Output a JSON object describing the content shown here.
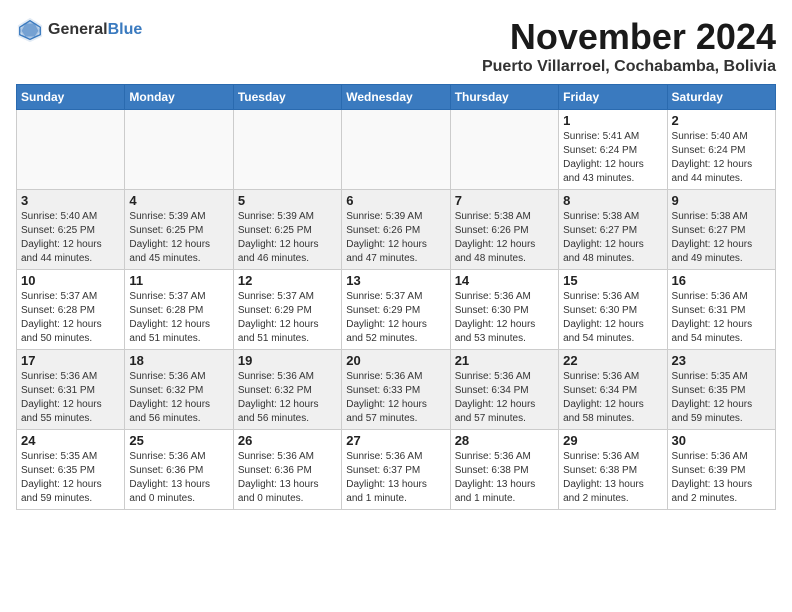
{
  "logo": {
    "line1": "General",
    "line2": "Blue"
  },
  "title": "November 2024",
  "subtitle": "Puerto Villarroel, Cochabamba, Bolivia",
  "days_of_week": [
    "Sunday",
    "Monday",
    "Tuesday",
    "Wednesday",
    "Thursday",
    "Friday",
    "Saturday"
  ],
  "weeks": [
    [
      {
        "num": "",
        "detail": "",
        "empty": true
      },
      {
        "num": "",
        "detail": "",
        "empty": true
      },
      {
        "num": "",
        "detail": "",
        "empty": true
      },
      {
        "num": "",
        "detail": "",
        "empty": true
      },
      {
        "num": "",
        "detail": "",
        "empty": true
      },
      {
        "num": "1",
        "detail": "Sunrise: 5:41 AM\nSunset: 6:24 PM\nDaylight: 12 hours\nand 43 minutes.",
        "empty": false
      },
      {
        "num": "2",
        "detail": "Sunrise: 5:40 AM\nSunset: 6:24 PM\nDaylight: 12 hours\nand 44 minutes.",
        "empty": false
      }
    ],
    [
      {
        "num": "3",
        "detail": "Sunrise: 5:40 AM\nSunset: 6:25 PM\nDaylight: 12 hours\nand 44 minutes.",
        "empty": false
      },
      {
        "num": "4",
        "detail": "Sunrise: 5:39 AM\nSunset: 6:25 PM\nDaylight: 12 hours\nand 45 minutes.",
        "empty": false
      },
      {
        "num": "5",
        "detail": "Sunrise: 5:39 AM\nSunset: 6:25 PM\nDaylight: 12 hours\nand 46 minutes.",
        "empty": false
      },
      {
        "num": "6",
        "detail": "Sunrise: 5:39 AM\nSunset: 6:26 PM\nDaylight: 12 hours\nand 47 minutes.",
        "empty": false
      },
      {
        "num": "7",
        "detail": "Sunrise: 5:38 AM\nSunset: 6:26 PM\nDaylight: 12 hours\nand 48 minutes.",
        "empty": false
      },
      {
        "num": "8",
        "detail": "Sunrise: 5:38 AM\nSunset: 6:27 PM\nDaylight: 12 hours\nand 48 minutes.",
        "empty": false
      },
      {
        "num": "9",
        "detail": "Sunrise: 5:38 AM\nSunset: 6:27 PM\nDaylight: 12 hours\nand 49 minutes.",
        "empty": false
      }
    ],
    [
      {
        "num": "10",
        "detail": "Sunrise: 5:37 AM\nSunset: 6:28 PM\nDaylight: 12 hours\nand 50 minutes.",
        "empty": false
      },
      {
        "num": "11",
        "detail": "Sunrise: 5:37 AM\nSunset: 6:28 PM\nDaylight: 12 hours\nand 51 minutes.",
        "empty": false
      },
      {
        "num": "12",
        "detail": "Sunrise: 5:37 AM\nSunset: 6:29 PM\nDaylight: 12 hours\nand 51 minutes.",
        "empty": false
      },
      {
        "num": "13",
        "detail": "Sunrise: 5:37 AM\nSunset: 6:29 PM\nDaylight: 12 hours\nand 52 minutes.",
        "empty": false
      },
      {
        "num": "14",
        "detail": "Sunrise: 5:36 AM\nSunset: 6:30 PM\nDaylight: 12 hours\nand 53 minutes.",
        "empty": false
      },
      {
        "num": "15",
        "detail": "Sunrise: 5:36 AM\nSunset: 6:30 PM\nDaylight: 12 hours\nand 54 minutes.",
        "empty": false
      },
      {
        "num": "16",
        "detail": "Sunrise: 5:36 AM\nSunset: 6:31 PM\nDaylight: 12 hours\nand 54 minutes.",
        "empty": false
      }
    ],
    [
      {
        "num": "17",
        "detail": "Sunrise: 5:36 AM\nSunset: 6:31 PM\nDaylight: 12 hours\nand 55 minutes.",
        "empty": false
      },
      {
        "num": "18",
        "detail": "Sunrise: 5:36 AM\nSunset: 6:32 PM\nDaylight: 12 hours\nand 56 minutes.",
        "empty": false
      },
      {
        "num": "19",
        "detail": "Sunrise: 5:36 AM\nSunset: 6:32 PM\nDaylight: 12 hours\nand 56 minutes.",
        "empty": false
      },
      {
        "num": "20",
        "detail": "Sunrise: 5:36 AM\nSunset: 6:33 PM\nDaylight: 12 hours\nand 57 minutes.",
        "empty": false
      },
      {
        "num": "21",
        "detail": "Sunrise: 5:36 AM\nSunset: 6:34 PM\nDaylight: 12 hours\nand 57 minutes.",
        "empty": false
      },
      {
        "num": "22",
        "detail": "Sunrise: 5:36 AM\nSunset: 6:34 PM\nDaylight: 12 hours\nand 58 minutes.",
        "empty": false
      },
      {
        "num": "23",
        "detail": "Sunrise: 5:35 AM\nSunset: 6:35 PM\nDaylight: 12 hours\nand 59 minutes.",
        "empty": false
      }
    ],
    [
      {
        "num": "24",
        "detail": "Sunrise: 5:35 AM\nSunset: 6:35 PM\nDaylight: 12 hours\nand 59 minutes.",
        "empty": false
      },
      {
        "num": "25",
        "detail": "Sunrise: 5:36 AM\nSunset: 6:36 PM\nDaylight: 13 hours\nand 0 minutes.",
        "empty": false
      },
      {
        "num": "26",
        "detail": "Sunrise: 5:36 AM\nSunset: 6:36 PM\nDaylight: 13 hours\nand 0 minutes.",
        "empty": false
      },
      {
        "num": "27",
        "detail": "Sunrise: 5:36 AM\nSunset: 6:37 PM\nDaylight: 13 hours\nand 1 minute.",
        "empty": false
      },
      {
        "num": "28",
        "detail": "Sunrise: 5:36 AM\nSunset: 6:38 PM\nDaylight: 13 hours\nand 1 minute.",
        "empty": false
      },
      {
        "num": "29",
        "detail": "Sunrise: 5:36 AM\nSunset: 6:38 PM\nDaylight: 13 hours\nand 2 minutes.",
        "empty": false
      },
      {
        "num": "30",
        "detail": "Sunrise: 5:36 AM\nSunset: 6:39 PM\nDaylight: 13 hours\nand 2 minutes.",
        "empty": false
      }
    ]
  ]
}
